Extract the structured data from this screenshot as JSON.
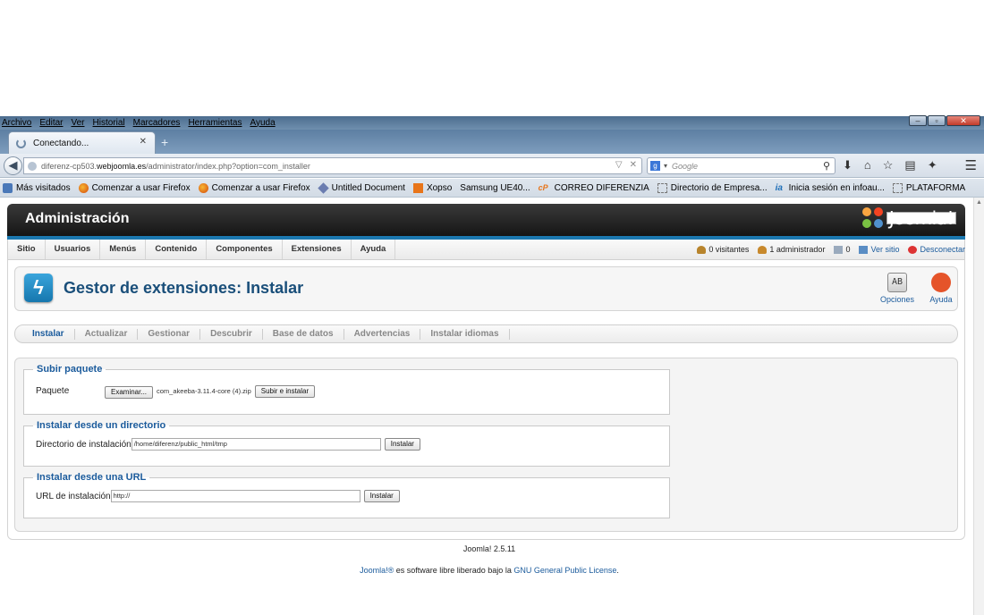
{
  "browser": {
    "menu": [
      "Archivo",
      "Editar",
      "Ver",
      "Historial",
      "Marcadores",
      "Herramientas",
      "Ayuda"
    ],
    "tab_title": "Conectando...",
    "new_tab": "+",
    "url_host_prefix": "diferenz-cp503.",
    "url_host": "webjoomla.es",
    "url_path": "/administrator/index.php?option=com_installer",
    "search_placeholder": "Google",
    "bookmarks": [
      "Más visitados",
      "Comenzar a usar Firefox",
      "Comenzar a usar Firefox",
      "Untitled Document",
      "Xopso",
      "Samsung UE40...",
      "CORREO DIFERENZIA",
      "Directorio de Empresa...",
      "Inicia sesión en infoau...",
      "PLATAFORMA"
    ]
  },
  "header": {
    "title": "Administración",
    "logo_text": "Joomla!"
  },
  "menu": [
    "Sitio",
    "Usuarios",
    "Menús",
    "Contenido",
    "Componentes",
    "Extensiones",
    "Ayuda"
  ],
  "status": {
    "visitors": "0 visitantes",
    "admins": "1 administrador",
    "messages": "0",
    "view_site": "Ver sitio",
    "logout": "Desconectar"
  },
  "page": {
    "title": "Gestor de extensiones: Instalar",
    "options_label": "Opciones",
    "help_label": "Ayuda"
  },
  "subtabs": [
    "Instalar",
    "Actualizar",
    "Gestionar",
    "Descubrir",
    "Base de datos",
    "Advertencias",
    "Instalar idiomas"
  ],
  "upload": {
    "legend": "Subir paquete",
    "label": "Paquete",
    "browse_button": "Examinar...",
    "file_name": "com_akeeba-3.11.4-core (4).zip",
    "submit_button": "Subir e instalar"
  },
  "directory": {
    "legend": "Instalar desde un directorio",
    "label": "Directorio de instalación",
    "value": "/home/diferenz/public_html/tmp",
    "button": "Instalar"
  },
  "url_install": {
    "legend": "Instalar desde una URL",
    "label": "URL de instalación",
    "value": "http://",
    "button": "Instalar"
  },
  "footer": {
    "version": "Joomla! 2.5.11",
    "license_prefix": "Joomla!®",
    "license_mid": " es software libre liberado bajo la ",
    "license_link": "GNU General Public License",
    "license_end": "."
  },
  "colors": {
    "accent": "#1b5b9c",
    "header_bg": "#1f1f1f",
    "header_line": "#1b78b0"
  }
}
